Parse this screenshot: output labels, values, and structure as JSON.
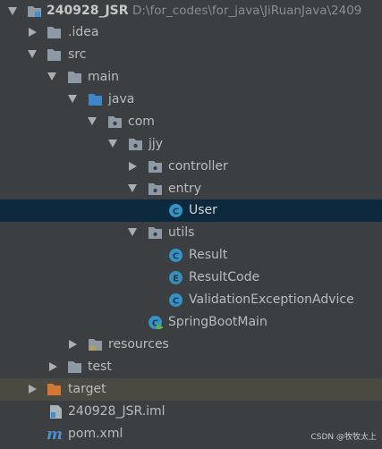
{
  "tree": {
    "project": {
      "name": "240928_JSR",
      "path": "D:\\for_codes\\for_java\\JiRuanJava\\2409"
    },
    "idea": {
      "label": ".idea"
    },
    "src": {
      "label": "src"
    },
    "main": {
      "label": "main"
    },
    "java": {
      "label": "java"
    },
    "com": {
      "label": "com"
    },
    "jjy": {
      "label": "jjy"
    },
    "controller": {
      "label": "controller"
    },
    "entry": {
      "label": "entry"
    },
    "user": {
      "label": "User"
    },
    "utils": {
      "label": "utils"
    },
    "result": {
      "label": "Result"
    },
    "result_code": {
      "label": "ResultCode"
    },
    "validation": {
      "label": "ValidationExceptionAdvice"
    },
    "spring_main": {
      "label": "SpringBootMain"
    },
    "resources": {
      "label": "resources"
    },
    "test": {
      "label": "test"
    },
    "target": {
      "label": "target"
    },
    "iml": {
      "label": "240928_JSR.iml"
    },
    "pom": {
      "label": "pom.xml"
    }
  },
  "icons": {
    "folder_color": "#8d9aa6",
    "excluded_folder_color": "#d47734",
    "class_color": "#3592c4",
    "enum_color": "#3a8fb8",
    "selected_row_color": "#0d293e"
  },
  "watermark": {
    "text": "CSDN @牧牧太上"
  }
}
